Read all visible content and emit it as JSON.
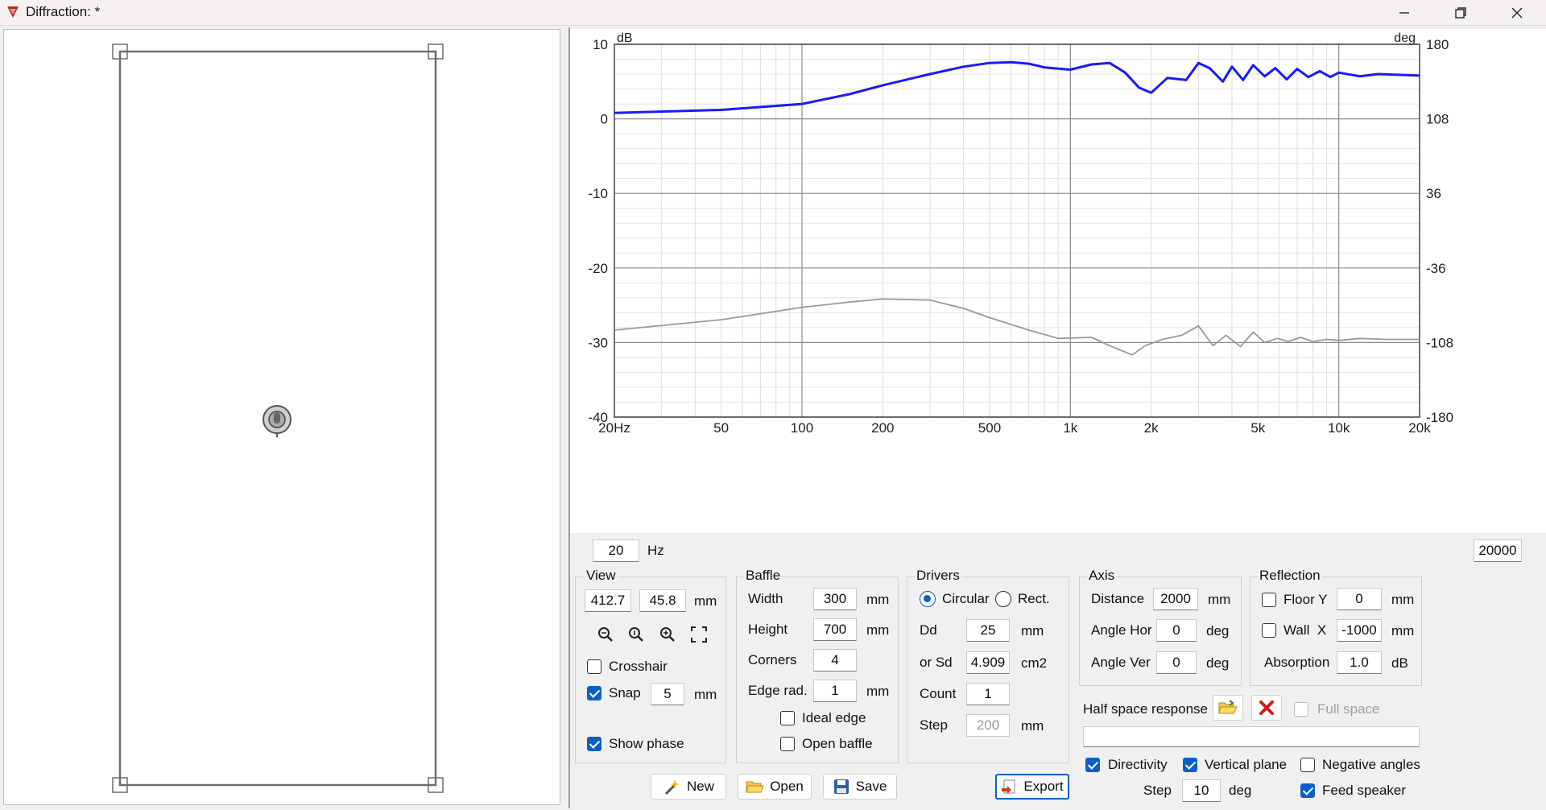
{
  "window": {
    "title": "Diffraction: *"
  },
  "chart_data": {
    "type": "line",
    "xscale": "log",
    "xlim": [
      20,
      20000
    ],
    "ylim_left": [
      -40,
      10
    ],
    "ylim_right": [
      -180,
      180
    ],
    "grid": true,
    "ylabel": "dB",
    "y2label": "deg",
    "xticks": [
      "20Hz",
      "50",
      "100",
      "200",
      "500",
      "1k",
      "2k",
      "5k",
      "10k",
      "20k"
    ],
    "yticks_left": [
      "10",
      "0",
      "-10",
      "-20",
      "-30",
      "-40"
    ],
    "yticks_right": [
      "180",
      "108",
      "36",
      "-36",
      "-108",
      "-180"
    ],
    "series": [
      {
        "color": "#1a1aff",
        "axis": "left",
        "x": [
          20,
          50,
          100,
          150,
          200,
          300,
          400,
          500,
          600,
          700,
          800,
          1000,
          1200,
          1400,
          1600,
          1800,
          2000,
          2300,
          2700,
          3000,
          3300,
          3700,
          4000,
          4400,
          4800,
          5300,
          5800,
          6400,
          7000,
          7700,
          8500,
          9300,
          10000,
          12000,
          14000,
          17000,
          20000
        ],
        "y": [
          0.8,
          1.2,
          2.0,
          3.3,
          4.5,
          6.0,
          7.0,
          7.5,
          7.6,
          7.4,
          6.9,
          6.6,
          7.3,
          7.5,
          6.2,
          4.2,
          3.5,
          5.5,
          5.2,
          7.5,
          6.8,
          5.0,
          7.0,
          5.2,
          7.2,
          5.7,
          6.8,
          5.3,
          6.7,
          5.6,
          6.4,
          5.6,
          6.2,
          5.7,
          6.0,
          5.9,
          5.8
        ]
      },
      {
        "color": "#9a9a9a",
        "axis": "right",
        "x": [
          20,
          50,
          100,
          150,
          200,
          300,
          400,
          500,
          700,
          900,
          1200,
          1400,
          1700,
          1900,
          2200,
          2600,
          3000,
          3400,
          3800,
          4300,
          4800,
          5300,
          5900,
          6500,
          7200,
          8000,
          9000,
          10000,
          12000,
          15000,
          20000
        ],
        "y": [
          -96,
          -86,
          -74,
          -69,
          -66,
          -67,
          -75,
          -84,
          -96,
          -104,
          -103,
          -111,
          -120,
          -111,
          -105,
          -101,
          -92,
          -111,
          -101,
          -112,
          -98,
          -108,
          -104,
          -107,
          -103,
          -107,
          -105,
          -106,
          -104,
          -105,
          -105
        ]
      }
    ]
  },
  "freq": {
    "start": "20",
    "unit": "Hz",
    "end": "20000"
  },
  "view": {
    "label": "View",
    "x": "412.7",
    "y": "45.8",
    "unit": "mm",
    "crosshair_label": "Crosshair",
    "crosshair": false,
    "snap_label": "Snap",
    "snap": true,
    "snap_value": "5",
    "snap_unit": "mm",
    "show_phase_label": "Show phase",
    "show_phase": true
  },
  "baffle": {
    "label": "Baffle",
    "width_label": "Width",
    "width": "300",
    "width_unit": "mm",
    "height_label": "Height",
    "height": "700",
    "height_unit": "mm",
    "corners_label": "Corners",
    "corners": "4",
    "edge_label": "Edge rad.",
    "edge": "1",
    "edge_unit": "mm",
    "ideal_edge_label": "Ideal edge",
    "ideal_edge": false,
    "open_baffle_label": "Open baffle",
    "open_baffle": false
  },
  "drivers": {
    "label": "Drivers",
    "circular_label": "Circular",
    "rect_label": "Rect.",
    "shape": "circular",
    "dd_label": "Dd",
    "dd": "25",
    "dd_unit": "mm",
    "sd_label": "or Sd",
    "sd": "4.909",
    "sd_unit": "cm2",
    "count_label": "Count",
    "count": "1",
    "step_label": "Step",
    "step": "200",
    "step_unit": "mm"
  },
  "axis": {
    "label": "Axis",
    "distance_label": "Distance",
    "distance": "2000",
    "distance_unit": "mm",
    "angle_hor_label": "Angle Hor",
    "angle_hor": "0",
    "angle_hor_unit": "deg",
    "angle_ver_label": "Angle Ver",
    "angle_ver": "0",
    "angle_ver_unit": "deg"
  },
  "reflection": {
    "label": "Reflection",
    "floor_label": "Floor Y",
    "floor": false,
    "floor_value": "0",
    "floor_unit": "mm",
    "wall_label": "Wall  X",
    "wall": false,
    "wall_value": "-1000",
    "wall_unit": "mm",
    "absorption_label": "Absorption",
    "absorption": "1.0",
    "absorption_unit": "dB"
  },
  "half_space": {
    "label": "Half space response",
    "full_space_label": "Full space",
    "full_space": false,
    "file": ""
  },
  "directivity": {
    "label": "Directivity",
    "enabled": true,
    "vertical_label": "Vertical plane",
    "vertical": true,
    "negative_label": "Negative angles",
    "negative": false,
    "step_label": "Step",
    "step": "10",
    "step_unit": "deg",
    "feed_label": "Feed speaker",
    "feed": true
  },
  "buttons": {
    "new": "New",
    "open": "Open",
    "save": "Save",
    "export": "Export"
  },
  "colors": {
    "accent": "#0b5fcb",
    "spl_line": "#1a1aff",
    "phase_line": "#9a9a9a"
  }
}
